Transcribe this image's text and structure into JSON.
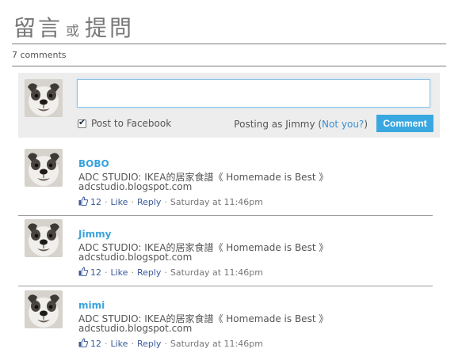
{
  "header": {
    "title_part1": "留言",
    "title_or": "或",
    "title_part2": "提問"
  },
  "comment_count": "7 comments",
  "composer": {
    "input_value": "",
    "post_to_facebook_label": "Post to Facebook",
    "post_to_facebook_checked": true,
    "posting_as_prefix": "Posting as Jimmy (",
    "not_you_link": "Not you?",
    "posting_as_suffix": ")",
    "submit_label": "Comment"
  },
  "comments": [
    {
      "author": "BOBO",
      "text": "ADC STUDIO: IKEA的居家食譜《 Homemade is Best 》",
      "link": "adcstudio.blogspot.com",
      "likes": "12",
      "like_label": "Like",
      "reply_label": "Reply",
      "timestamp": "Saturday at 11:46pm"
    },
    {
      "author": "Jimmy",
      "text": "ADC STUDIO: IKEA的居家食譜《 Homemade is Best 》",
      "link": "adcstudio.blogspot.com",
      "likes": "12",
      "like_label": "Like",
      "reply_label": "Reply",
      "timestamp": "Saturday at 11:46pm"
    },
    {
      "author": "mimi",
      "text": "ADC STUDIO: IKEA的居家食譜《 Homemade is Best 》",
      "link": "adcstudio.blogspot.com",
      "likes": "12",
      "like_label": "Like",
      "reply_label": "Reply",
      "timestamp": "Saturday at 11:46pm"
    }
  ],
  "colors": {
    "accent_blue": "#3aa8e0",
    "link_blue": "#3b5998",
    "composer_bg": "#ededed"
  },
  "icons": {
    "avatar": "bulldog-avatar-icon",
    "like": "thumbs-up-icon",
    "checkbox": "checkmark-icon"
  }
}
